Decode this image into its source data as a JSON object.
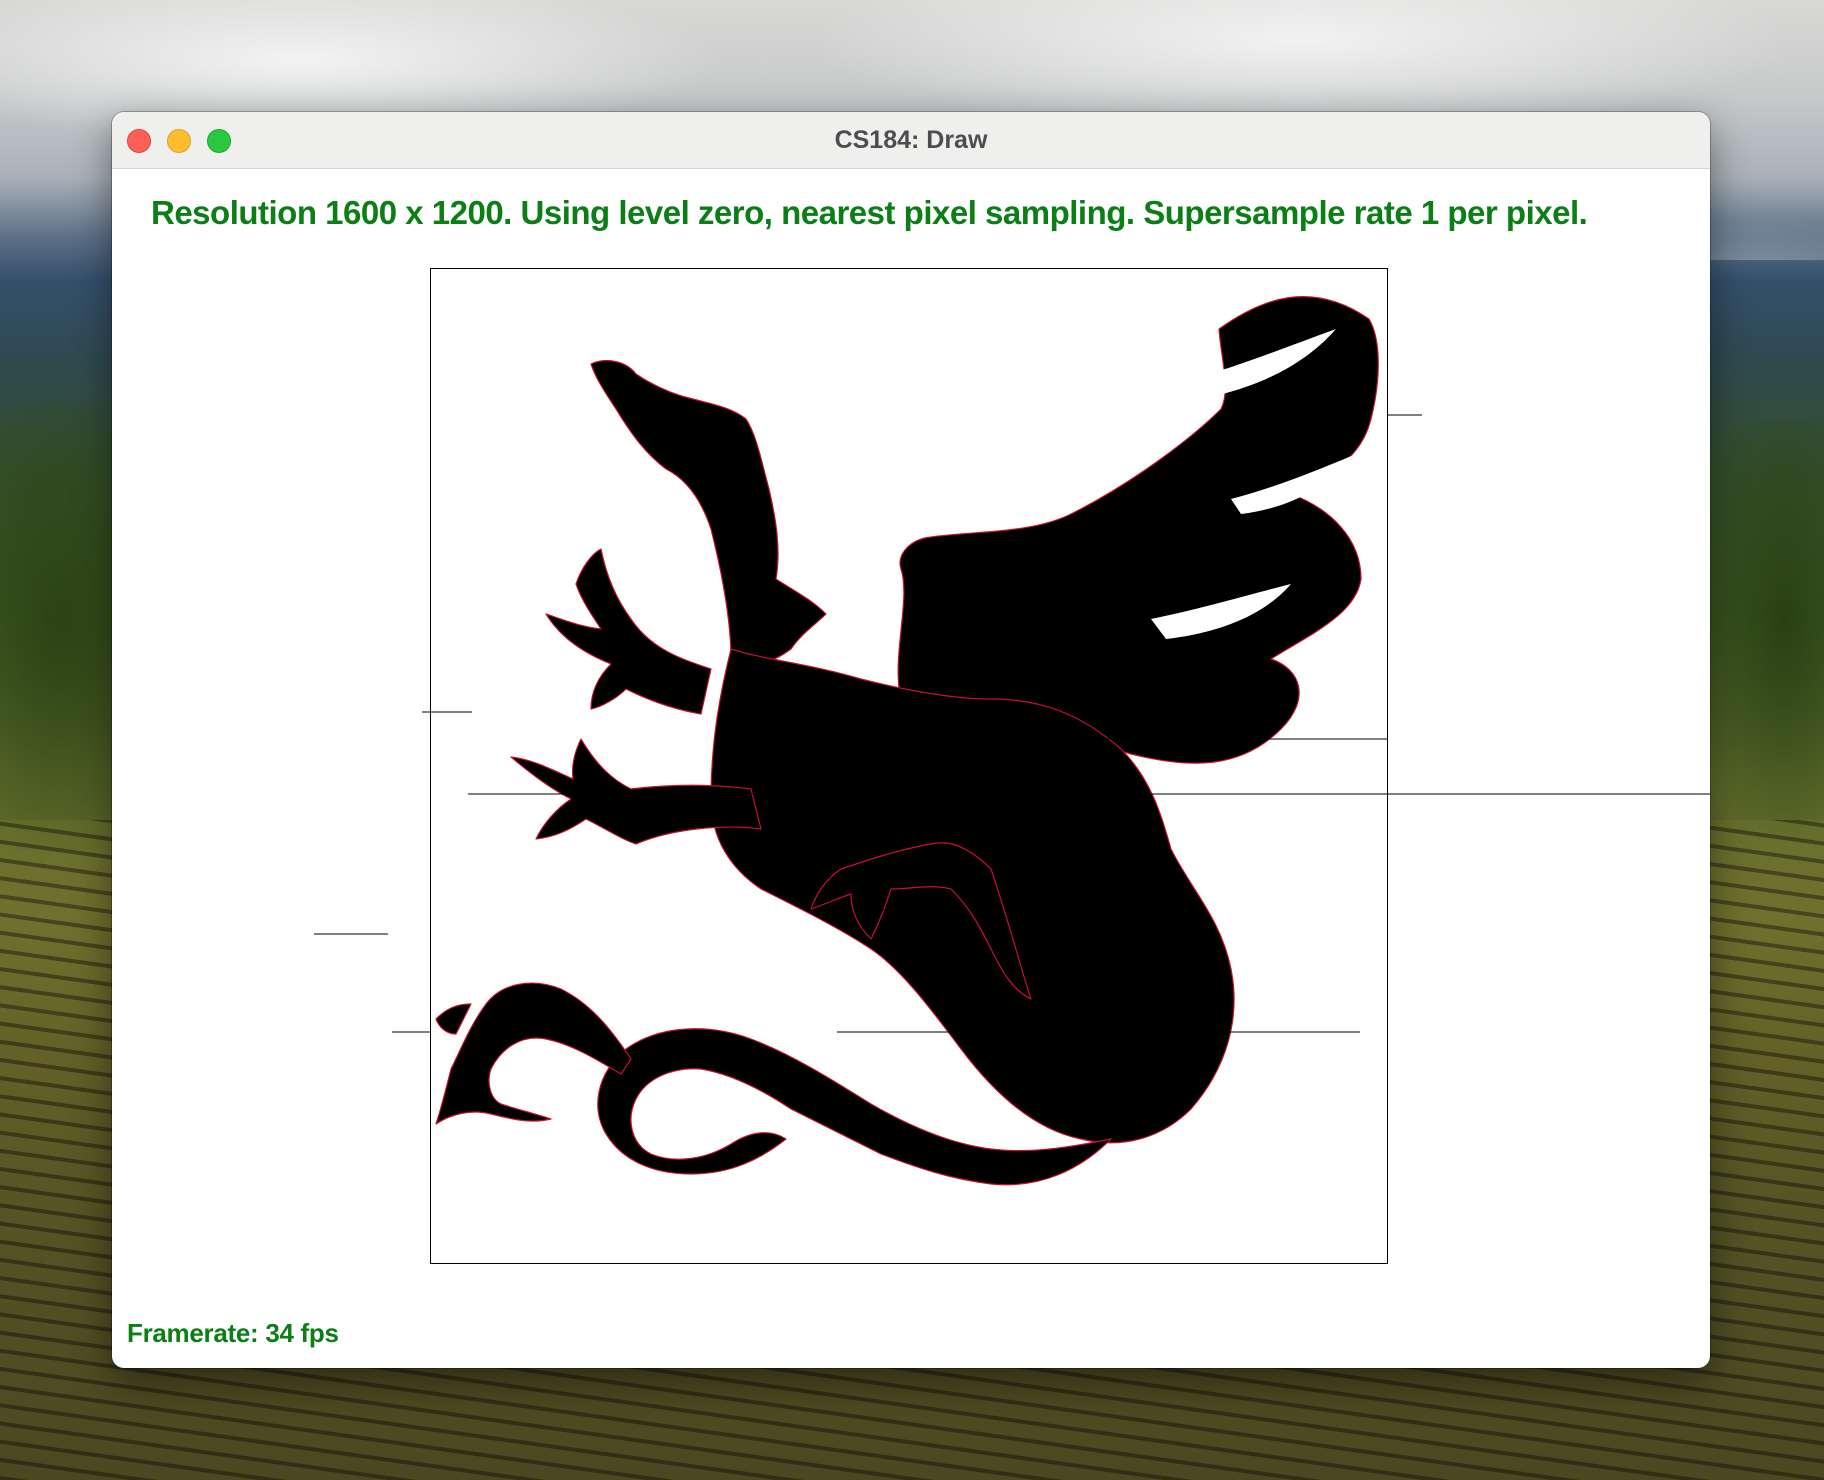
{
  "desktop": {
    "wallpaper": "vineyard-hills-landscape"
  },
  "window": {
    "title": "CS184: Draw",
    "controls": {
      "close": "close-icon",
      "minimize": "minimize-icon",
      "zoom": "zoom-icon",
      "close_color": "#fe5f57",
      "minimize_color": "#febc2e",
      "zoom_color": "#28c840"
    }
  },
  "status": {
    "text": "Resolution 1600 x 1200. Using level zero, nearest pixel sampling. Supersample rate 1 per pixel.",
    "color": "#0b7e16"
  },
  "footer": {
    "framerate": "Framerate: 34 fps"
  },
  "drawing": {
    "subject": "dragon-silhouette",
    "fill_color": "#000000",
    "edge_color": "#c8102e"
  }
}
